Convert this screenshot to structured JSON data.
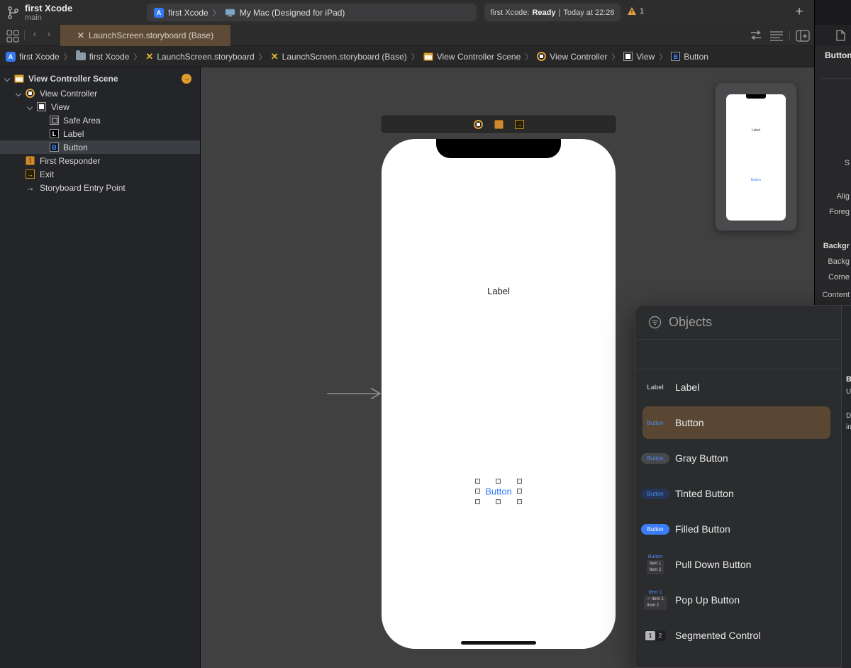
{
  "colors": {
    "accent_blue": "#3478f6",
    "warning_yellow": "#e7a33c",
    "tab_selected_brown": "#5d4b38",
    "library_selected_brown": "#5a4733",
    "canvas_gray": "#404040",
    "sidebar_dark": "#242528"
  },
  "toolbar": {
    "project_name": "first Xcode",
    "branch_name": "main",
    "scheme": {
      "target": "first Xcode",
      "separator": "〉",
      "destination": "My Mac (Designed for iPad)"
    },
    "status": {
      "prefix": "first Xcode:",
      "state": "Ready",
      "divider": "|",
      "time": "Today at 22:26"
    },
    "warning_count": "1",
    "add_label": "+"
  },
  "tabbar": {
    "active_tab_label": "LaunchScreen.storyboard (Base)",
    "storyboard_glyph": "✕",
    "back_glyph": "‹",
    "forward_glyph": "›"
  },
  "jumpbar": {
    "separator": "〉",
    "items": [
      {
        "icon": "project-icon",
        "glyph": "A",
        "label": "first Xcode"
      },
      {
        "icon": "folder-icon",
        "label": "first Xcode"
      },
      {
        "icon": "storyboard-icon",
        "glyph": "✕",
        "label": "LaunchScreen.storyboard"
      },
      {
        "icon": "storyboard-icon",
        "glyph": "✕",
        "label": "LaunchScreen.storyboard (Base)"
      },
      {
        "icon": "scene-icon",
        "label": "View Controller Scene"
      },
      {
        "icon": "view-controller-icon",
        "label": "View Controller"
      },
      {
        "icon": "view-icon",
        "label": "View"
      },
      {
        "icon": "button-icon",
        "glyph": "B",
        "label": "Button"
      }
    ]
  },
  "outline": {
    "rows": [
      {
        "label": "View Controller Scene"
      },
      {
        "label": "View Controller"
      },
      {
        "label": "View"
      },
      {
        "label": "Safe Area"
      },
      {
        "label": "Label",
        "glyph": "L"
      },
      {
        "label": "Button",
        "glyph": "B"
      },
      {
        "label": "First Responder",
        "glyph": "1"
      },
      {
        "label": "Exit",
        "glyph": "→"
      },
      {
        "label": "Storyboard Entry Point",
        "glyph": "→"
      }
    ]
  },
  "canvas": {
    "label_text": "Label",
    "button_text": "Button"
  },
  "preview": {
    "label_text": "Label",
    "button_text": "Button"
  },
  "library": {
    "title": "Objects",
    "items": [
      {
        "label": "Label",
        "icon_text": "Label"
      },
      {
        "label": "Button",
        "icon_text": "Button"
      },
      {
        "label": "Gray Button",
        "icon_text": "Button"
      },
      {
        "label": "Tinted Button",
        "icon_text": "Button"
      },
      {
        "label": "Filled Button",
        "icon_text": "Button"
      },
      {
        "label": "Pull Down Button",
        "icon_text": "Button",
        "menu": [
          "Item 1",
          "Item 2"
        ]
      },
      {
        "label": "Pop Up Button",
        "icon_text": "Item 1",
        "menu": [
          "✓ Item 1",
          "Item 2"
        ]
      },
      {
        "label": "Segmented Control",
        "segments": [
          "1",
          "2"
        ]
      }
    ],
    "detail_fragments": [
      "B",
      "U",
      "D",
      "in"
    ]
  },
  "inspector": {
    "title": "Button",
    "fragments": [
      "S",
      "Alig",
      "Foreg",
      "Backgr",
      "Backg",
      "Corne",
      "Content"
    ]
  }
}
